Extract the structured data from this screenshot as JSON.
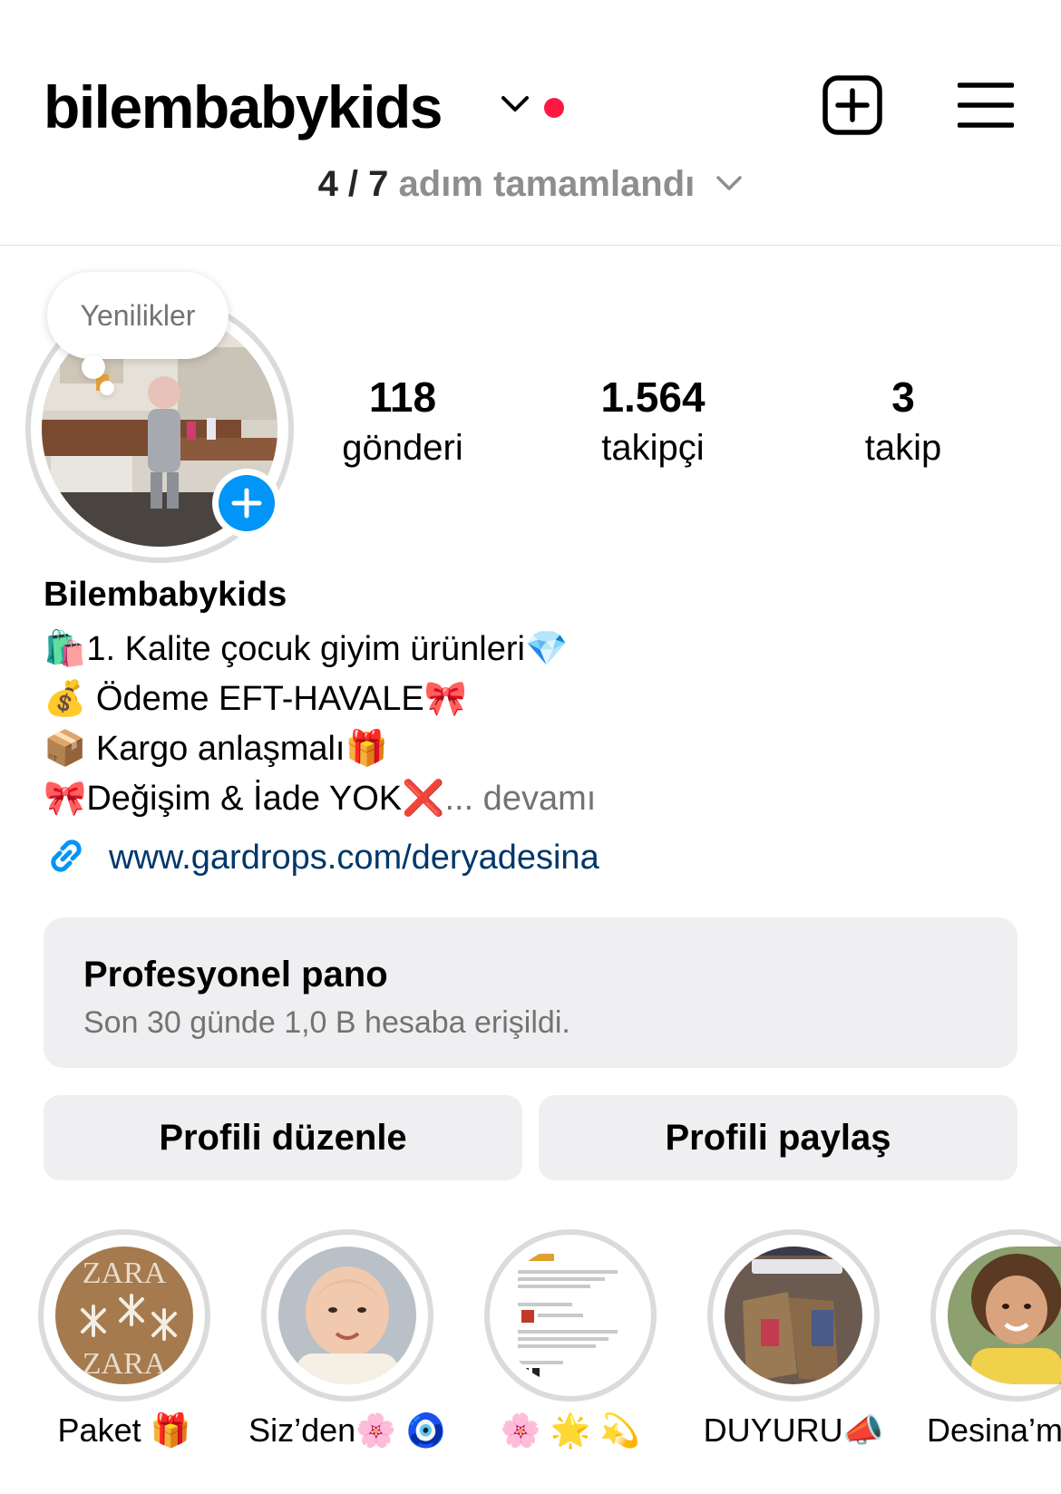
{
  "header": {
    "username": "bilembabykids",
    "setup_progress": "4 / 7",
    "setup_progress_text": "adım tamamlandı"
  },
  "profile": {
    "note": "Yenilikler",
    "stats": [
      {
        "value": "118",
        "label": "gönderi"
      },
      {
        "value": "1.564",
        "label": "takipçi"
      },
      {
        "value": "3",
        "label": "takip"
      }
    ],
    "display_name": "Bilembabykids",
    "bio_lines": [
      {
        "emoji": "🛍️",
        "text": "1. Kalite çocuk giyim ürünleri",
        "emoji_end": "💎"
      },
      {
        "emoji": "💰",
        "text": " Ödeme EFT-HAVALE",
        "emoji_end": "🎀"
      },
      {
        "emoji": "📦",
        "text": "  Kargo anlaşmalı",
        "emoji_end": "🎁"
      },
      {
        "emoji": "🎀",
        "text": "Değişim & İade YOK",
        "emoji_end": "❌"
      }
    ],
    "bio_more": "... devamı",
    "link": "www.gardrops.com/deryadesina"
  },
  "dashboard": {
    "title": "Profesyonel pano",
    "subtitle": "Son 30 günde 1,0 B hesaba erişildi."
  },
  "buttons": {
    "edit": "Profili düzenle",
    "share": "Profili paylaş"
  },
  "highlights": [
    {
      "label": "Paket 🎁"
    },
    {
      "label": "Siz’den🌸 🧿"
    },
    {
      "label": "🌸 🌟 💫"
    },
    {
      "label": "DUYURU📣"
    },
    {
      "label": "Desina’m"
    }
  ],
  "colors": {
    "accent_blue": "#0095f6",
    "link_blue": "#00376b",
    "notification_red": "#ff1744",
    "button_gray": "#efeff1"
  }
}
